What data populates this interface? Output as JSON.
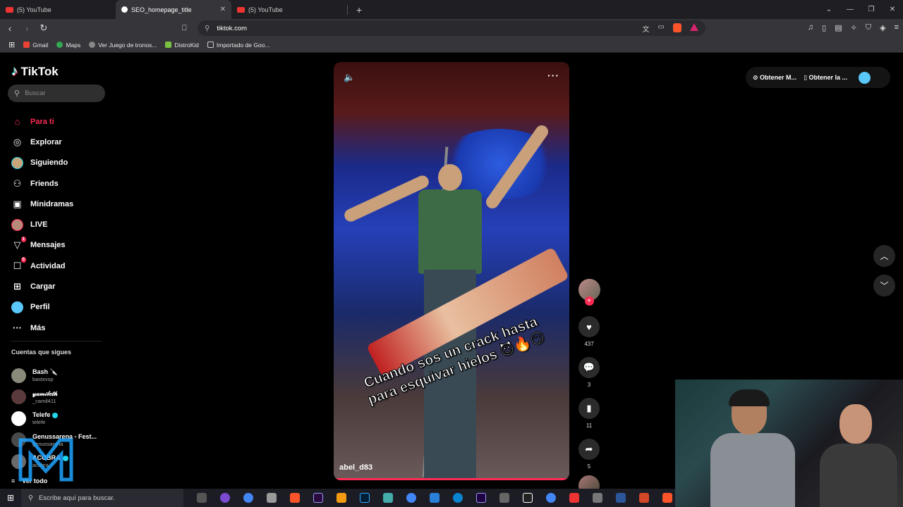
{
  "browser": {
    "tabs": [
      {
        "label": "(5) YouTube"
      },
      {
        "label": "SEO_homepage_title",
        "active": true
      },
      {
        "label": "(5) YouTube"
      }
    ],
    "url": "tiktok.com",
    "bookmarks": [
      "Gmail",
      "Maps",
      "Ver Juego de tronos...",
      "DistroKid",
      "Importado de Goo..."
    ]
  },
  "tiktok": {
    "logo": "TikTok",
    "search_placeholder": "Buscar",
    "nav": [
      {
        "label": "Para ti",
        "icon": "home-icon",
        "active": true
      },
      {
        "label": "Explorar",
        "icon": "compass-icon"
      },
      {
        "label": "Siguiendo",
        "icon": "avatar"
      },
      {
        "label": "Friends",
        "icon": "friends-icon"
      },
      {
        "label": "Minidramas",
        "icon": "film-icon"
      },
      {
        "label": "LIVE",
        "icon": "live-icon"
      },
      {
        "label": "Mensajes",
        "icon": "send-icon",
        "badge": "1"
      },
      {
        "label": "Actividad",
        "icon": "inbox-icon",
        "badge": "5"
      },
      {
        "label": "Cargar",
        "icon": "plus-square-icon"
      },
      {
        "label": "Perfil",
        "icon": "profile-avatar"
      },
      {
        "label": "Más",
        "icon": "more-icon"
      }
    ],
    "following_header": "Cuentas que sigues",
    "following": [
      {
        "name": "Bash 🔪",
        "handle": "bastxvsp"
      },
      {
        "name": "𝓎𝒶𝓂𝒾𝓁𝑒𝓉𝒽",
        "handle": "_camil411"
      },
      {
        "name": "Telefe",
        "handle": "telefe",
        "verified": true
      },
      {
        "name": "Genussarena - Fest...",
        "handle": "genussarena"
      },
      {
        "name": "ACOBRA",
        "handle": "acobra",
        "verified": true
      }
    ],
    "see_all": "Ver todo",
    "video": {
      "caption_line1": "Cuando sos un crack hasta",
      "caption_line2": "para esquivar hielos 😈🔥😏",
      "username": "abel_d83"
    },
    "actions": {
      "likes": "437",
      "comments": "3",
      "saves": "11",
      "shares": "5"
    },
    "topbar": {
      "btn1": "Obtener M...",
      "btn2": "Obtener la ..."
    }
  },
  "taskbar": {
    "search_placeholder": "Escribe aquí para buscar."
  }
}
